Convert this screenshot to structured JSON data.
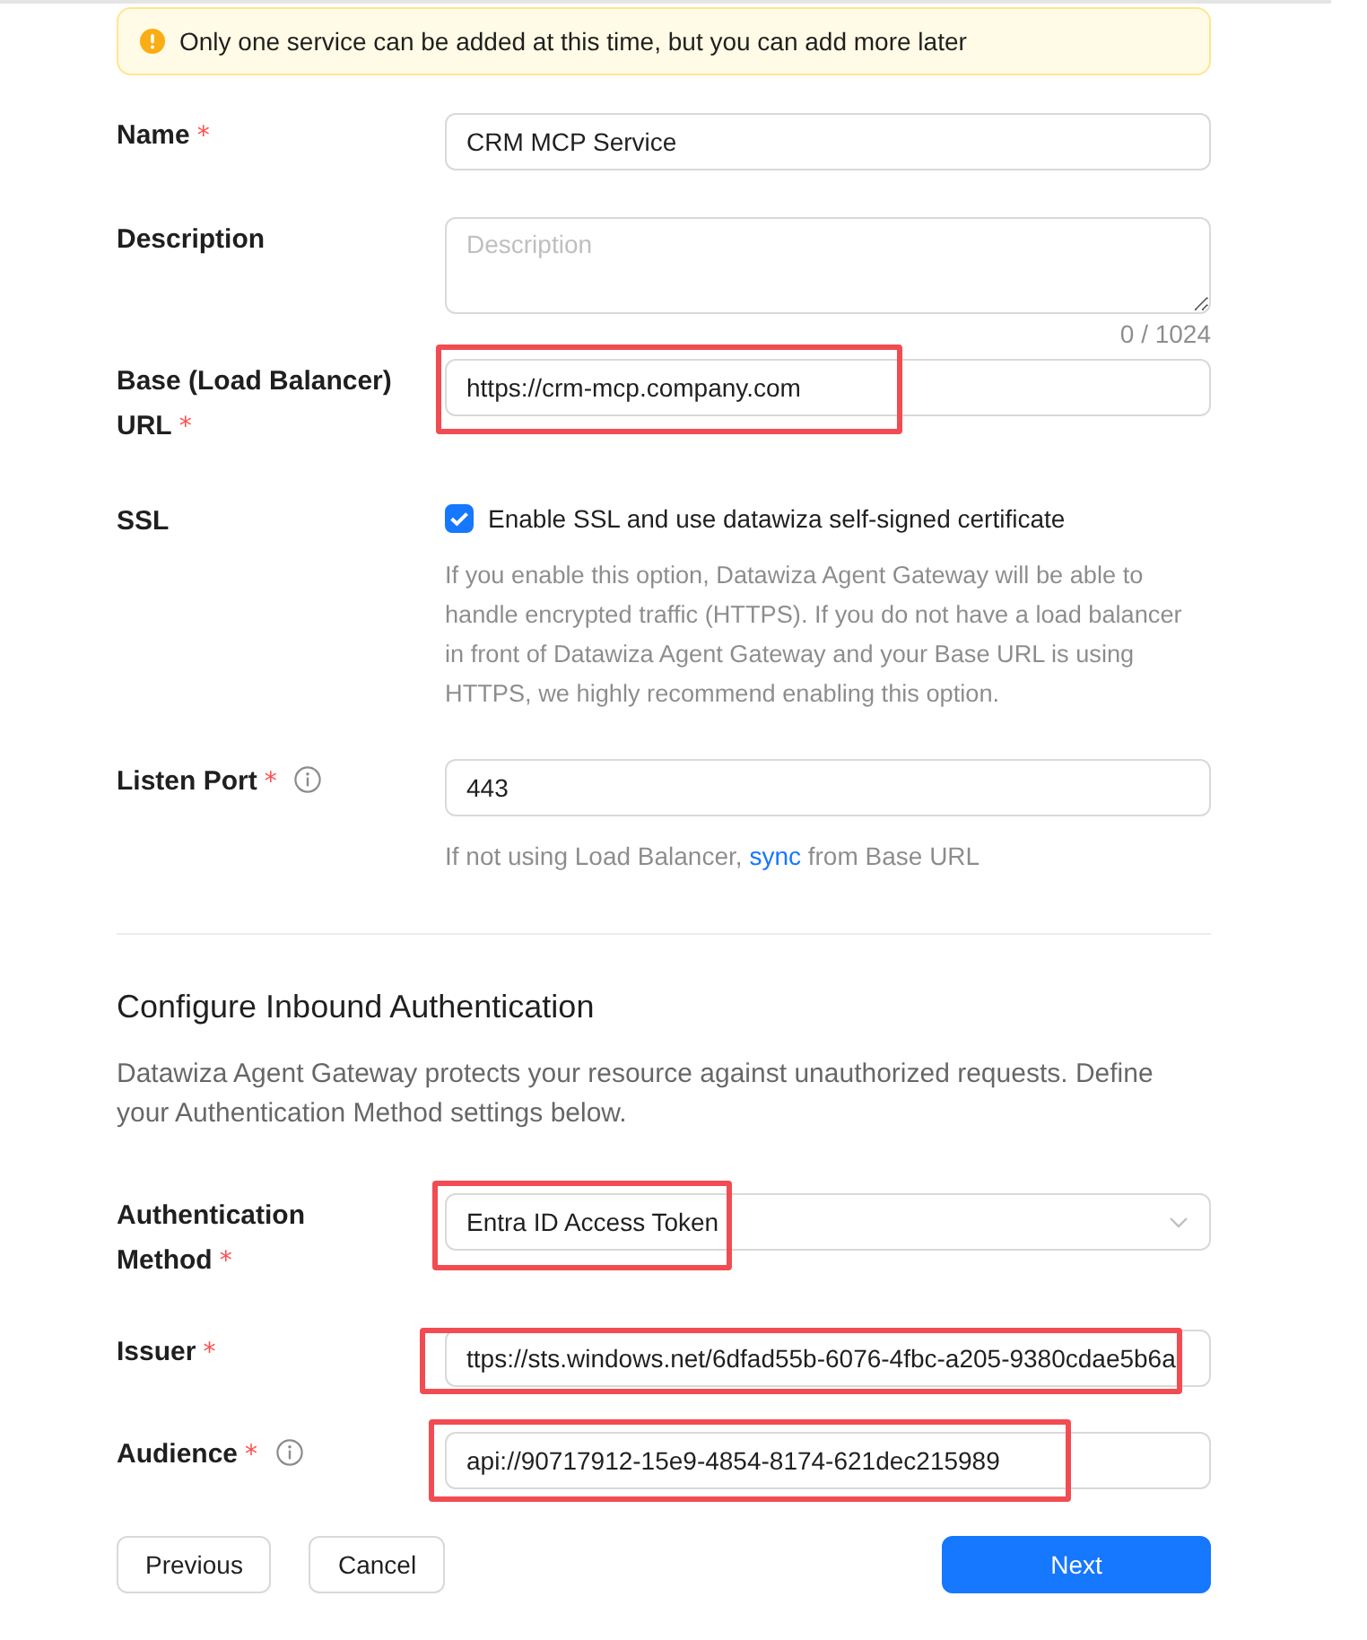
{
  "notice": {
    "text": "Only one service can be added at this time, but you can add more later"
  },
  "fields": [
    {
      "kind": "text",
      "label": "Name",
      "required_mark": "*",
      "value": "CRM MCP Service",
      "highlighted": false
    },
    {
      "kind": "textarea",
      "label": "Description",
      "placeholder": "Description",
      "counter": "0 / 1024",
      "highlighted": false
    },
    {
      "kind": "text",
      "label": "Base (Load Balancer) URL",
      "required_mark": "*",
      "value": "https://crm-mcp.company.com",
      "highlighted": true
    },
    {
      "kind": "checkbox",
      "label": "SSL",
      "checked": true,
      "option": "Enable SSL and use datawiza self-signed certificate",
      "help": "If you enable this option, Datawiza Agent Gateway will be able to handle encrypted traffic (HTTPS). If you do not have a load balancer in front of Datawiza Agent Gateway and your Base URL is using HTTPS, we highly recommend enabling this option.",
      "highlighted": false
    },
    {
      "kind": "text",
      "label": "Listen Port",
      "required_mark": "*",
      "info": true,
      "value": "443",
      "help": {
        "before": "If not using Load Balancer,",
        "link": "sync",
        "after": "from Base URL"
      },
      "highlighted": false
    }
  ],
  "auth_section": {
    "title": "Configure Inbound Authentication",
    "description": "Datawiza Agent Gateway protects your resource against unauthorized requests. Define your Authentication Method settings below.",
    "fields": [
      {
        "kind": "select",
        "label": "Authentication Method",
        "required_mark": "*",
        "value": "Entra ID Access Token",
        "highlighted": true
      },
      {
        "kind": "text",
        "label": "Issuer",
        "required_mark": "*",
        "value": "ttps://sts.windows.net/6dfad55b-6076-4fbc-a205-9380cdae5b6a",
        "highlighted": true
      },
      {
        "kind": "text",
        "label": "Audience",
        "required_mark": "*",
        "info": true,
        "value": "api://90717912-15e9-4854-8174-621dec215989",
        "highlighted": true
      }
    ]
  },
  "buttons": [
    {
      "label": "Previous",
      "kind": "default"
    },
    {
      "label": "Cancel",
      "kind": "default"
    },
    {
      "label": "Next",
      "kind": "primary"
    }
  ]
}
